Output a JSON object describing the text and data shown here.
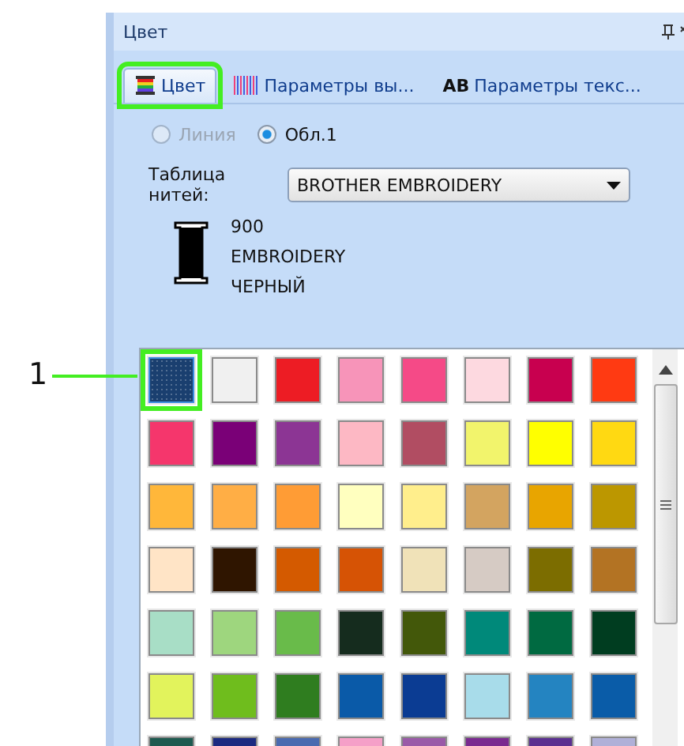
{
  "panel": {
    "title": "Цвет"
  },
  "tabs": [
    {
      "kind": "spool",
      "label": "Цвет",
      "selected": true,
      "highlighted": true
    },
    {
      "kind": "stripes",
      "label": "Параметры вы...",
      "selected": false,
      "highlighted": false
    },
    {
      "kind": "text",
      "icon_text": "AB",
      "label": "Параметры текс...",
      "selected": false,
      "highlighted": false
    }
  ],
  "radios": [
    {
      "label": "Линия",
      "selected": false,
      "disabled": true
    },
    {
      "label": "Обл.1",
      "selected": true,
      "disabled": false
    }
  ],
  "thread_table": {
    "label_lines": [
      "Таблица",
      "нитей:"
    ],
    "value": "BROTHER EMBROIDERY"
  },
  "thread": {
    "lines": [
      "900",
      "EMBROIDERY",
      "ЧЕРНЫЙ"
    ],
    "color": "#000000"
  },
  "callout": {
    "label": "1"
  },
  "swatch_rows": [
    [
      {
        "color": "#1a3f6f",
        "selected": true
      },
      {
        "color": "#f0f0f0",
        "selected": false
      },
      {
        "color": "#ed1c24",
        "selected": false
      },
      {
        "color": "#f794b9",
        "selected": false
      },
      {
        "color": "#f54a87",
        "selected": false
      },
      {
        "color": "#fdd9e0",
        "selected": false
      },
      {
        "color": "#c8004f",
        "selected": false
      },
      {
        "color": "#ff3a12",
        "selected": false
      }
    ],
    [
      {
        "color": "#f5366c",
        "selected": false
      },
      {
        "color": "#7a0077",
        "selected": false
      },
      {
        "color": "#8c3594",
        "selected": false
      },
      {
        "color": "#fdb8c4",
        "selected": false
      },
      {
        "color": "#b14d62",
        "selected": false
      },
      {
        "color": "#f2f46c",
        "selected": false
      },
      {
        "color": "#ffff00",
        "selected": false
      },
      {
        "color": "#ffd912",
        "selected": false
      }
    ],
    [
      {
        "color": "#ffb73a",
        "selected": false
      },
      {
        "color": "#ffae45",
        "selected": false
      },
      {
        "color": "#ff9c35",
        "selected": false
      },
      {
        "color": "#ffffbf",
        "selected": false
      },
      {
        "color": "#ffee8c",
        "selected": false
      },
      {
        "color": "#d3a460",
        "selected": false
      },
      {
        "color": "#e8a500",
        "selected": false
      },
      {
        "color": "#bc9700",
        "selected": false
      }
    ],
    [
      {
        "color": "#ffe4c6",
        "selected": false
      },
      {
        "color": "#2f1500",
        "selected": false
      },
      {
        "color": "#d45a00",
        "selected": false
      },
      {
        "color": "#d65305",
        "selected": false
      },
      {
        "color": "#f0e2b8",
        "selected": false
      },
      {
        "color": "#d6cbc4",
        "selected": false
      },
      {
        "color": "#7c6d00",
        "selected": false
      },
      {
        "color": "#b37323",
        "selected": false
      }
    ],
    [
      {
        "color": "#a8dec6",
        "selected": false
      },
      {
        "color": "#9ed67e",
        "selected": false
      },
      {
        "color": "#69bb4a",
        "selected": false
      },
      {
        "color": "#152c1e",
        "selected": false
      },
      {
        "color": "#43580a",
        "selected": false
      },
      {
        "color": "#00897a",
        "selected": false
      },
      {
        "color": "#006a41",
        "selected": false
      },
      {
        "color": "#003d20",
        "selected": false
      }
    ],
    [
      {
        "color": "#e2f35c",
        "selected": false
      },
      {
        "color": "#6fbd1d",
        "selected": false
      },
      {
        "color": "#2f7d1f",
        "selected": false
      },
      {
        "color": "#0a5aa8",
        "selected": false
      },
      {
        "color": "#0b3c93",
        "selected": false
      },
      {
        "color": "#a8dcea",
        "selected": false
      },
      {
        "color": "#2484c1",
        "selected": false
      },
      {
        "color": "#0a5ca8",
        "selected": false
      }
    ],
    [
      {
        "color": "#1e5a50",
        "selected": false
      },
      {
        "color": "#1c2a80",
        "selected": false
      },
      {
        "color": "#4a6ab0",
        "selected": false
      },
      {
        "color": "#f5a0c8",
        "selected": false
      },
      {
        "color": "#9a5aa8",
        "selected": false
      },
      {
        "color": "#7a2a90",
        "selected": false
      },
      {
        "color": "#5a3090",
        "selected": false
      },
      {
        "color": "#b0b0d8",
        "selected": false
      }
    ]
  ]
}
